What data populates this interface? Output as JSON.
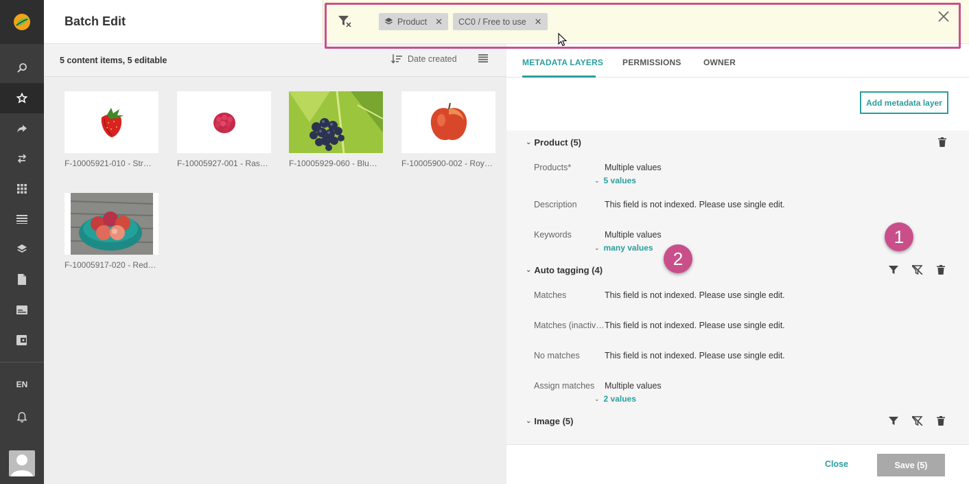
{
  "app": {
    "title": "Batch Edit",
    "language": "EN"
  },
  "rail": {
    "items": [
      "search-icon",
      "star-icon",
      "share-icon",
      "transfer-icon",
      "grid-icon",
      "list-icon",
      "layers-icon",
      "document-icon",
      "card-icon",
      "wallet-icon"
    ],
    "active": "star-icon"
  },
  "content": {
    "count_label": "5 content items, 5 editable",
    "sort_label": "Date created",
    "items": [
      {
        "caption": "F-10005921-010 - Str…",
        "kind": "strawberry"
      },
      {
        "caption": "F-10005927-001 - Ras…",
        "kind": "raspberry"
      },
      {
        "caption": "F-10005929-060 - Blu…",
        "kind": "blueberries"
      },
      {
        "caption": "F-10005900-002 - Roy…",
        "kind": "apple"
      },
      {
        "caption": "F-10005917-020 - Red…",
        "kind": "apple-bowl"
      }
    ]
  },
  "filter_bar": {
    "chips": [
      {
        "label": "Product",
        "has_layer_icon": true
      },
      {
        "label": "CC0 / Free to use",
        "has_layer_icon": false
      }
    ]
  },
  "tabs": [
    {
      "label": "METADATA LAYERS",
      "active": true
    },
    {
      "label": "PERMISSIONS",
      "active": false
    },
    {
      "label": "OWNER",
      "active": false
    }
  ],
  "add_layer_label": "Add metadata layer",
  "sections": {
    "product": {
      "title": "Product (5)",
      "fields": {
        "products_label": "Products*",
        "products_value": "Multiple values",
        "products_link": "5 values",
        "description_label": "Description",
        "description_value": "This field is not indexed. Please use single edit.",
        "keywords_label": "Keywords",
        "keywords_value": "Multiple values",
        "keywords_link": "many values"
      }
    },
    "auto_tagging": {
      "title": "Auto tagging (4)",
      "fields": {
        "matches_label": "Matches",
        "matches_value": "This field is not indexed. Please use single edit.",
        "inactive_label": "Matches (inactiv…",
        "inactive_value": "This field is not indexed. Please use single edit.",
        "nomatch_label": "No matches",
        "nomatch_value": "This field is not indexed. Please use single edit.",
        "assign_label": "Assign matches",
        "assign_value": "Multiple values",
        "assign_link": "2 values"
      }
    },
    "image": {
      "title": "Image (5)"
    }
  },
  "footer": {
    "close_label": "Close",
    "save_label": "Save (5)"
  },
  "badges": {
    "one": "1",
    "two": "2"
  },
  "colors": {
    "accent": "#2a9d9d",
    "highlight": "#c94f8a",
    "rail": "#3c3c3c"
  }
}
